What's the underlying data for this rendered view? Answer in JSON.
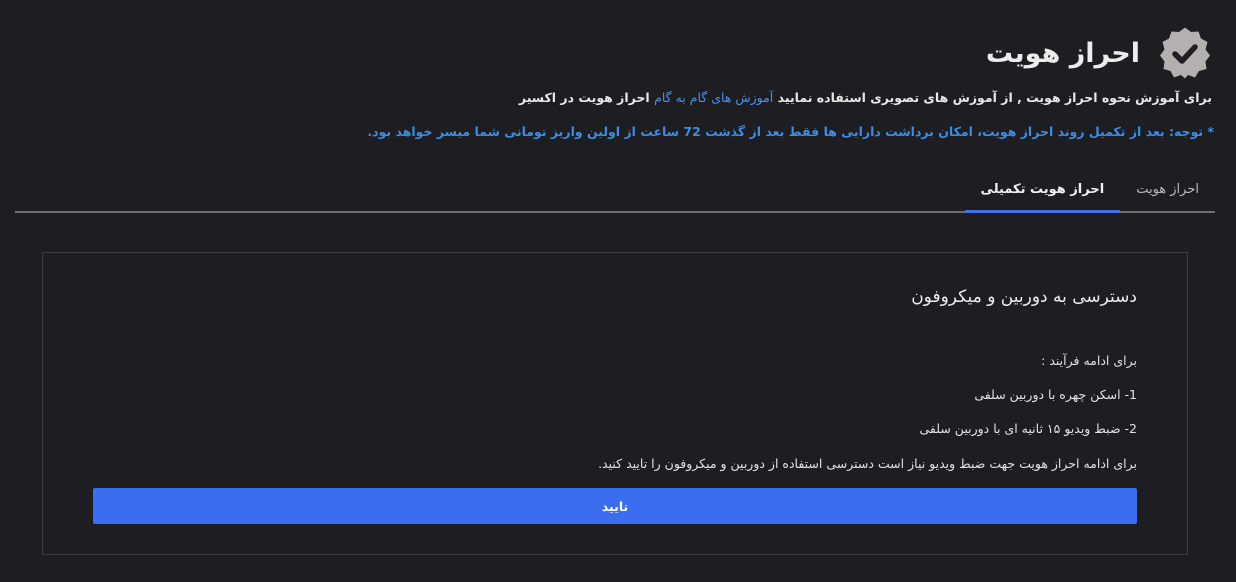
{
  "header": {
    "title": "احراز هویت",
    "icon": "verified-badge-icon"
  },
  "intro": {
    "text_before": "برای آموزش نحوه احراز هویت , از آموزش های تصویری استفاده نمایید",
    "link": "آموزش های گام به گام",
    "text_after": "احراز هویت در اکسیر"
  },
  "notice": "* توجه: بعد از تکمیل روند احراز هویت، امکان برداشت دارایی ها فقط بعد از گذشت 72 ساعت از اولین واریز تومانی شما میسر خواهد بود.",
  "tabs": [
    {
      "label": "احراز هویت",
      "active": false
    },
    {
      "label": "احراز هویت تکمیلی",
      "active": true
    }
  ],
  "card": {
    "title": "دسترسی به دوربین و میکروفون",
    "intro": "برای ادامه فرآیند :",
    "steps": [
      "1- اسکن چهره با دوربین سلفی",
      "2- ضبط ویدیو ۱۵ ثانیه ای با دوربین سلفی"
    ],
    "description": "برای ادامه احراز هویت جهت ضبط ویدیو نیاز است دسترسی استفاده از دوربین و میکروفون را تایید کنید.",
    "confirm_label": "تایید"
  },
  "colors": {
    "background": "#1e1d22",
    "accent": "#3a6df0",
    "link": "#4a90f0",
    "notice": "#3a8ee6"
  }
}
